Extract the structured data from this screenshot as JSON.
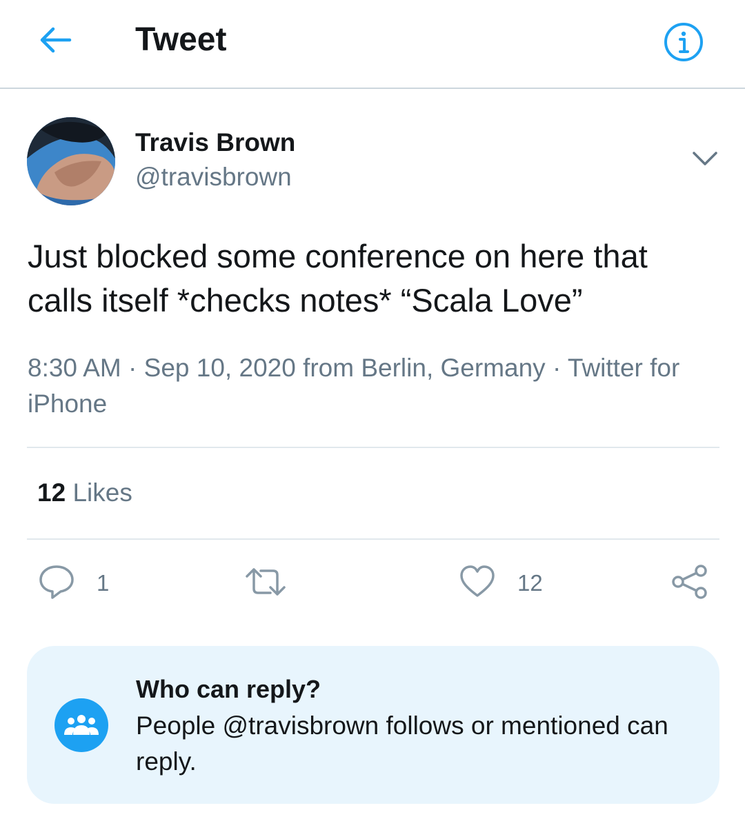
{
  "header": {
    "title": "Tweet",
    "back_icon": "arrow-left-icon",
    "info_icon": "info-circle-icon",
    "accent_color": "#1da1f2"
  },
  "author": {
    "name": "Travis Brown",
    "handle": "@travisbrown",
    "menu_icon": "chevron-down-icon"
  },
  "tweet": {
    "text": "Just blocked some conference on here that calls itself *checks notes* “Scala Love”",
    "time": "8:30 AM",
    "date": "Sep 10, 2020",
    "from_word": "from",
    "location": "Berlin, Germany",
    "separator": "·",
    "source": "Twitter for iPhone"
  },
  "stats": {
    "likes_count": "12",
    "likes_label": "Likes"
  },
  "actions": {
    "reply_count": "1",
    "retweet_count": "",
    "like_count": "12",
    "icons": [
      "reply-icon",
      "retweet-icon",
      "like-icon",
      "share-icon"
    ]
  },
  "reply_settings": {
    "title": "Who can reply?",
    "description": "People @travisbrown follows or mentioned can reply.",
    "icon": "people-icon"
  },
  "colors": {
    "text_primary": "#14171a",
    "text_secondary": "#657786",
    "divider": "#e1e8ed",
    "reply_box_bg": "#e8f5fd"
  }
}
